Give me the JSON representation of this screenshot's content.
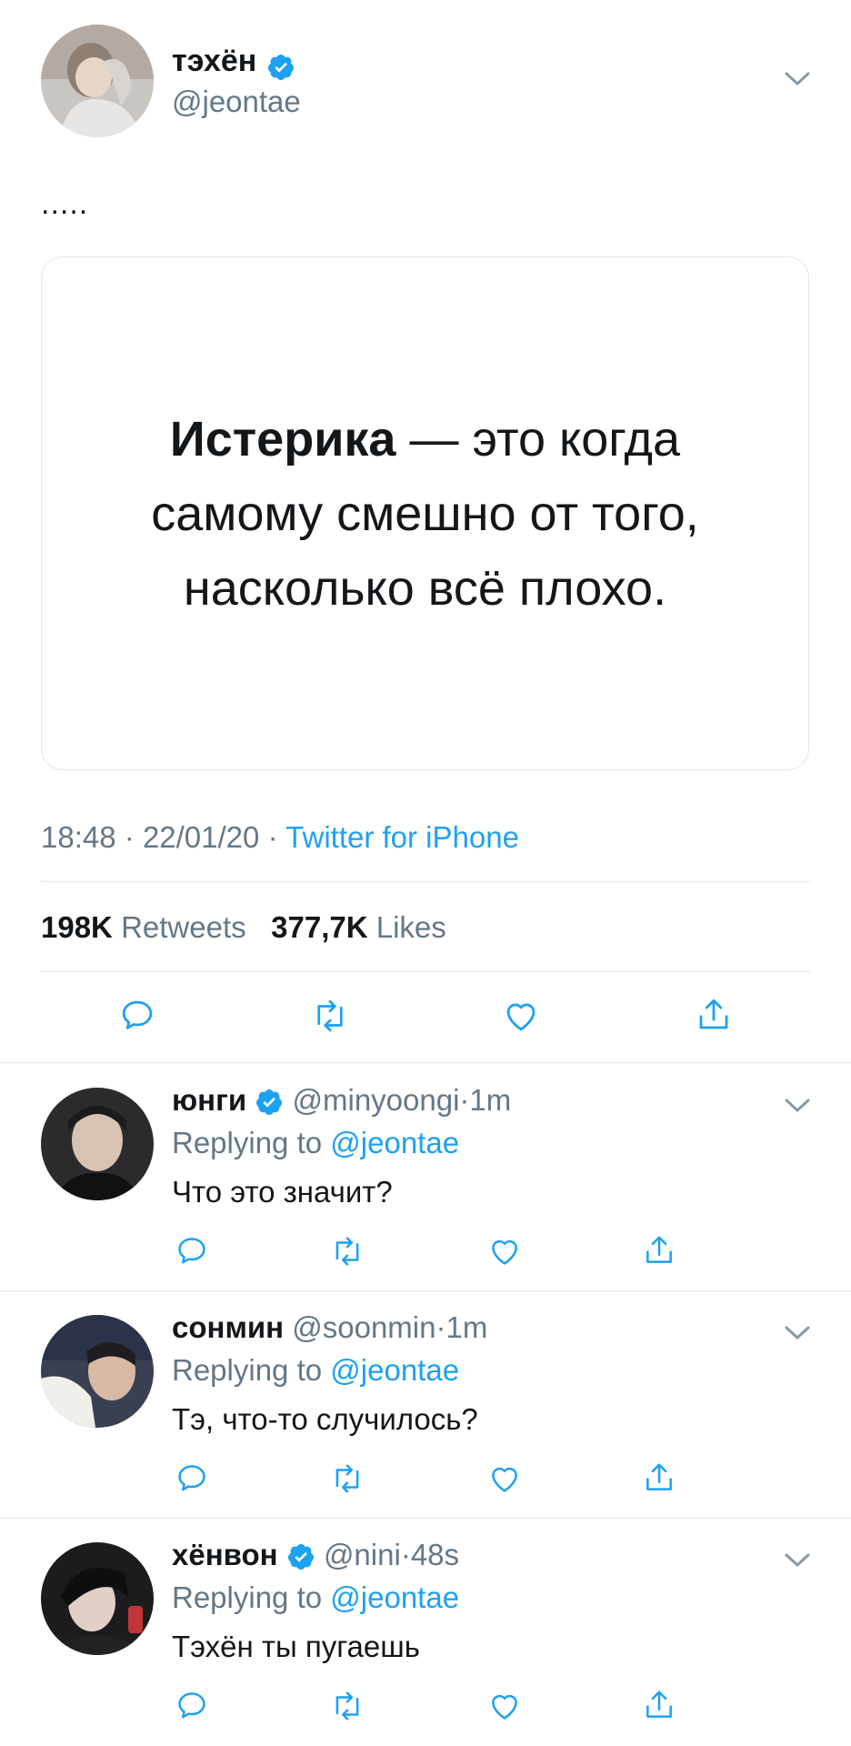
{
  "main_tweet": {
    "display_name": "тэхён",
    "handle": "@jeontae",
    "verified": true,
    "text": ".....",
    "media_text": {
      "bold": "Истерика",
      "rest_line1": " — это когда",
      "line2": "самому смешно от того,",
      "line3": "насколько всё плохо."
    },
    "time": "18:48",
    "date": "22/01/20",
    "source": "Twitter for iPhone",
    "retweets_count": "198K",
    "retweets_label": "Retweets",
    "likes_count": "377,7K",
    "likes_label": "Likes"
  },
  "replies": [
    {
      "display_name": "юнги",
      "verified": true,
      "handle": "@minyoongi",
      "time": "1m",
      "replying_label": "Replying to",
      "replying_to": "@jeontae",
      "text": "Что это значит?"
    },
    {
      "display_name": "сонмин",
      "verified": false,
      "handle": "@soonmin",
      "time": "1m",
      "replying_label": "Replying to",
      "replying_to": "@jeontae",
      "text": "Тэ, что-то случилось?"
    },
    {
      "display_name": "хёнвон",
      "verified": true,
      "handle": "@nini",
      "time": "48s",
      "replying_label": "Replying to",
      "replying_to": "@jeontae",
      "text": "Тэхён ты пугаешь"
    }
  ],
  "separators": {
    "dot": "·"
  },
  "icons": {
    "reply": "reply-icon",
    "retweet": "retweet-icon",
    "like": "heart-icon",
    "share": "share-icon",
    "more": "chevron-down-icon",
    "verified": "verified-badge-icon"
  },
  "colors": {
    "accent": "#1da1f2",
    "muted": "#657786",
    "text": "#14171a",
    "divider": "#e1e8ed"
  }
}
